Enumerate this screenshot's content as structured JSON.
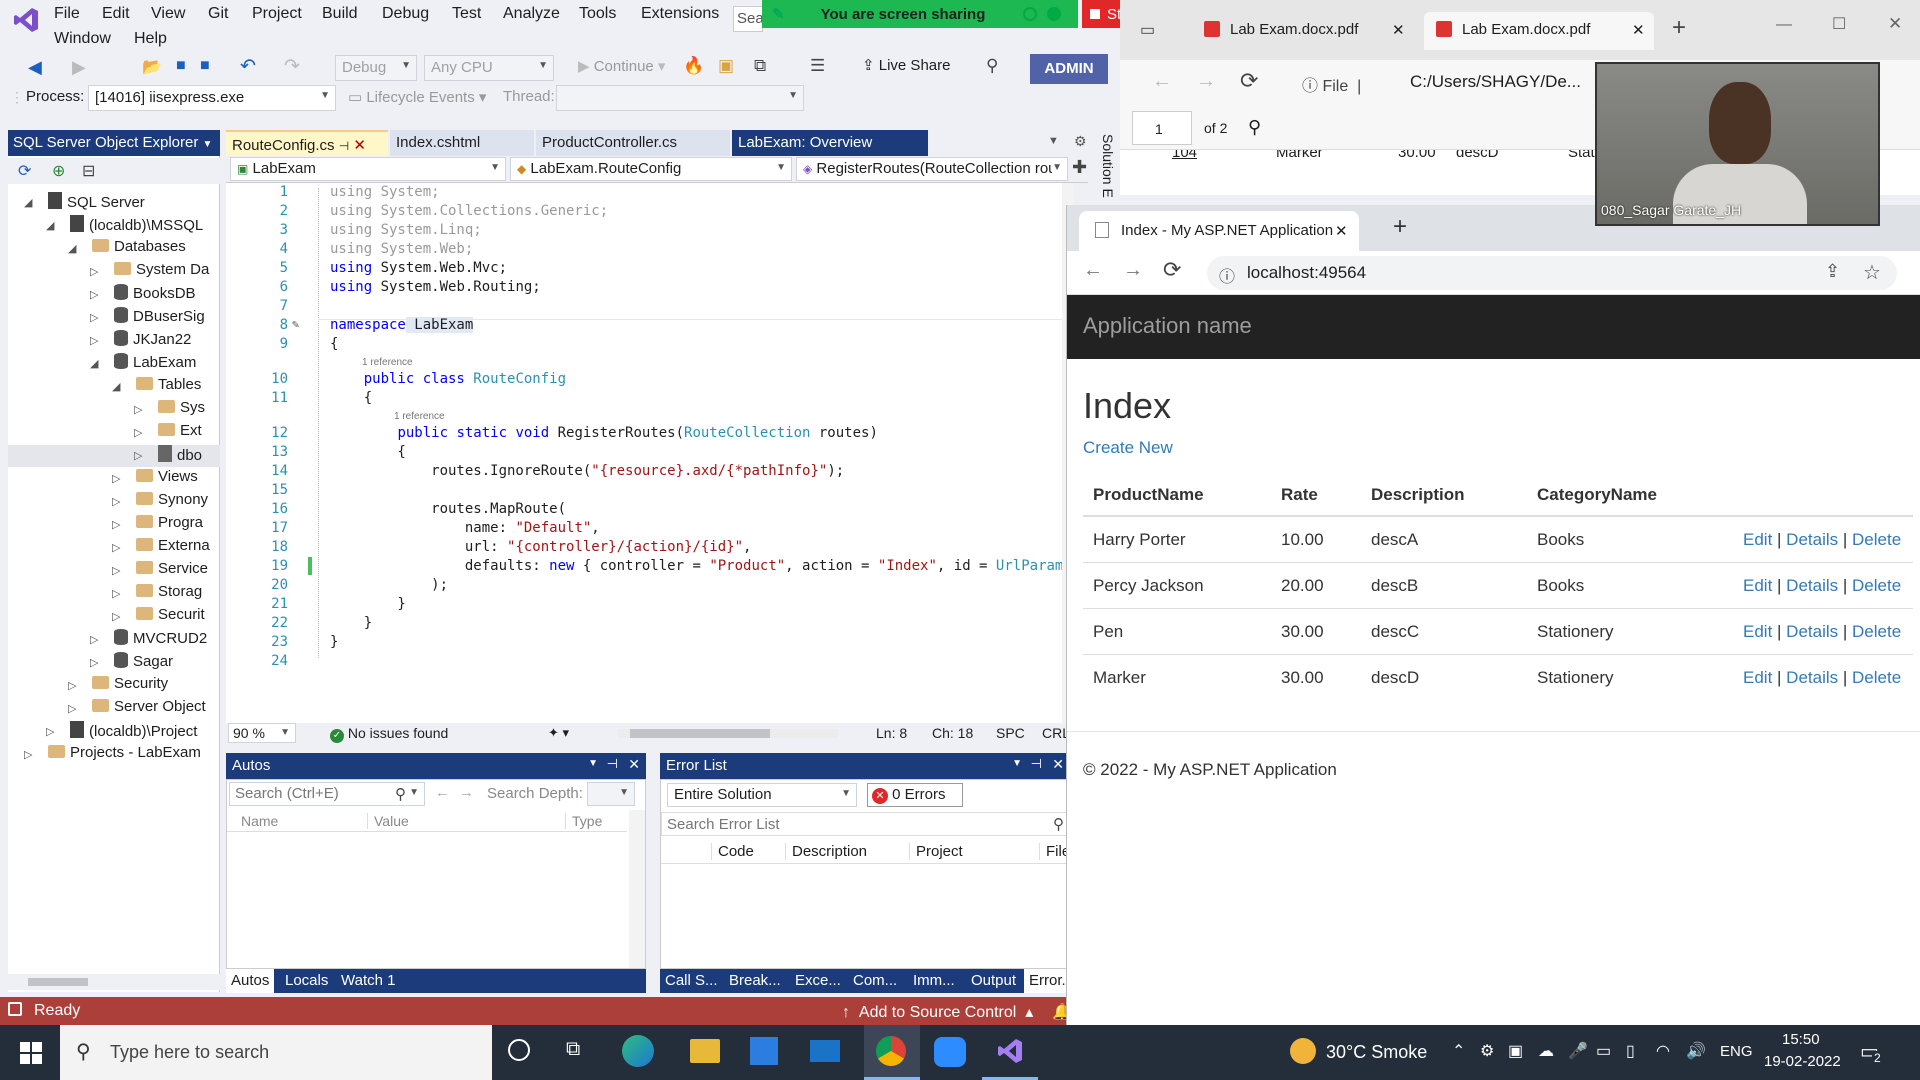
{
  "vs": {
    "menu": [
      "File",
      "Edit",
      "View",
      "Git",
      "Project",
      "Build",
      "Debug",
      "Test",
      "Analyze",
      "Tools",
      "Extensions",
      "Window",
      "Help"
    ],
    "search_placeholder": "Sea",
    "toolbar": {
      "config": "Debug",
      "platform": "Any CPU",
      "continue_label": "Continue",
      "live_share": "Live Share",
      "admin": "ADMIN",
      "process_label": "Process:",
      "process_value": "[14016] iisexpress.exe",
      "lifecycle": "Lifecycle Events",
      "thread_label": "Thread:"
    },
    "sse": {
      "title": "SQL Server Object Explorer",
      "items": [
        {
          "label": "SQL Server"
        },
        {
          "label": "(localdb)\\MSSQL"
        },
        {
          "label": "Databases"
        },
        {
          "label": "System Da"
        },
        {
          "label": "BooksDB"
        },
        {
          "label": "DBuserSig"
        },
        {
          "label": "JKJan22"
        },
        {
          "label": "LabExam"
        },
        {
          "label": "Tables"
        },
        {
          "label": "Sys"
        },
        {
          "label": "Ext"
        },
        {
          "label": "dbo"
        },
        {
          "label": "Views"
        },
        {
          "label": "Synony"
        },
        {
          "label": "Progra"
        },
        {
          "label": "Externa"
        },
        {
          "label": "Service"
        },
        {
          "label": "Storag"
        },
        {
          "label": "Securit"
        },
        {
          "label": "MVCRUD2"
        },
        {
          "label": "Sagar"
        },
        {
          "label": "Security"
        },
        {
          "label": "Server Object"
        },
        {
          "label": "(localdb)\\Project"
        },
        {
          "label": "Projects - LabExam"
        }
      ]
    },
    "tabs": [
      "RouteConfig.cs",
      "Index.cshtml",
      "ProductController.cs",
      "LabExam: Overview"
    ],
    "solution_explorer_label": "Solution E",
    "nav": {
      "project": "LabExam",
      "class": "LabExam.RouteConfig",
      "member": "RegisterRoutes(RouteCollection rou"
    },
    "code": {
      "line_numbers": [
        "1",
        "2",
        "3",
        "4",
        "5",
        "6",
        "7",
        "8",
        "9",
        "10",
        "11",
        "12",
        "13",
        "14",
        "15",
        "16",
        "17",
        "18",
        "19",
        "20",
        "21",
        "22",
        "23",
        "24"
      ],
      "l1": "using System;",
      "l2": "using System.Collections.Generic;",
      "l3": "using System.Linq;",
      "l4": "using System.Web;",
      "l5_kw": "using",
      "l5": " System.Web.Mvc;",
      "l6_kw": "using",
      "l6": " System.Web.Routing;",
      "l8_kw": "namespace",
      "l8": " LabExam",
      "l9": "{",
      "ref1": "1 reference",
      "l10_kw": "public class",
      "l10_ty": " RouteConfig",
      "l11": "    {",
      "ref2": "1 reference",
      "l12_kw": "public static void",
      "l12_a": " RegisterRoutes(",
      "l12_ty": "RouteCollection",
      "l12_b": " routes)",
      "l13": "        {",
      "l14_a": "            routes.IgnoreRoute(",
      "l14_s": "\"{resource}.axd/{*pathInfo}\"",
      "l14_b": ");",
      "l16": "            routes.MapRoute(",
      "l17_a": "                name: ",
      "l17_s": "\"Default\"",
      "l17_b": ",",
      "l18_a": "                url: ",
      "l18_s": "\"{controller}/{action}/{id}\"",
      "l18_b": ",",
      "l19_a": "                defaults: ",
      "l19_kw": "new",
      "l19_b": " { controller = ",
      "l19_s1": "\"Product\"",
      "l19_c": ", action = ",
      "l19_s2": "\"Index\"",
      "l19_d": ", id = ",
      "l19_ty": "UrlParameter",
      "l20": "            );",
      "l21": "        }",
      "l22": "    }",
      "l23": "}"
    },
    "code_status": {
      "zoom": "90 %",
      "issues": "No issues found",
      "ln": "Ln: 8",
      "ch": "Ch: 18",
      "spc": "SPC",
      "crlf": "CRLF"
    },
    "autos": {
      "title": "Autos",
      "search_placeholder": "Search (Ctrl+E)",
      "search_depth": "Search Depth:",
      "columns": [
        "Name",
        "Value",
        "Type"
      ],
      "tabs": [
        "Autos",
        "Locals",
        "Watch 1"
      ]
    },
    "errors": {
      "title": "Error List",
      "scope": "Entire Solution",
      "count": "0 Errors",
      "search_placeholder": "Search Error List",
      "columns": [
        "Code",
        "Description",
        "Project",
        "File"
      ],
      "tabs": [
        "Call S...",
        "Break...",
        "Exce...",
        "Com...",
        "Imm...",
        "Output",
        "Error..."
      ]
    },
    "status": {
      "ready": "Ready",
      "source_control": "Add to Source Control"
    }
  },
  "share": {
    "sharing": "You are screen sharing",
    "stop": "Stop Share"
  },
  "pdf": {
    "tabs": [
      "Lab Exam.docx.pdf",
      "Lab Exam.docx.pdf"
    ],
    "file_label": "File",
    "path": "C:/Users/SHAGY/De...",
    "page": "1",
    "of": "of 2",
    "peek": [
      "104",
      "Marker",
      "30.00",
      "descD",
      "Stati"
    ]
  },
  "webcam": {
    "name": "080_Sagar Garate_JH"
  },
  "web": {
    "tab_title": "Index - My ASP.NET Application",
    "url": "localhost:49564",
    "app_name": "Application name",
    "heading": "Index",
    "create_new": "Create New",
    "columns": [
      "ProductName",
      "Rate",
      "Description",
      "CategoryName"
    ],
    "rows": [
      [
        "Harry Porter",
        "10.00",
        "descA",
        "Books"
      ],
      [
        "Percy Jackson",
        "20.00",
        "descB",
        "Books"
      ],
      [
        "Pen",
        "30.00",
        "descC",
        "Stationery"
      ],
      [
        "Marker",
        "30.00",
        "descD",
        "Stationery"
      ]
    ],
    "actions": [
      "Edit",
      "Details",
      "Delete"
    ],
    "footer": "© 2022 - My ASP.NET Application"
  },
  "taskbar": {
    "search_placeholder": "Type here to search",
    "weather": "30°C  Smoke",
    "lang": "ENG",
    "time": "15:50",
    "date": "19-02-2022",
    "notif_count": "2"
  }
}
